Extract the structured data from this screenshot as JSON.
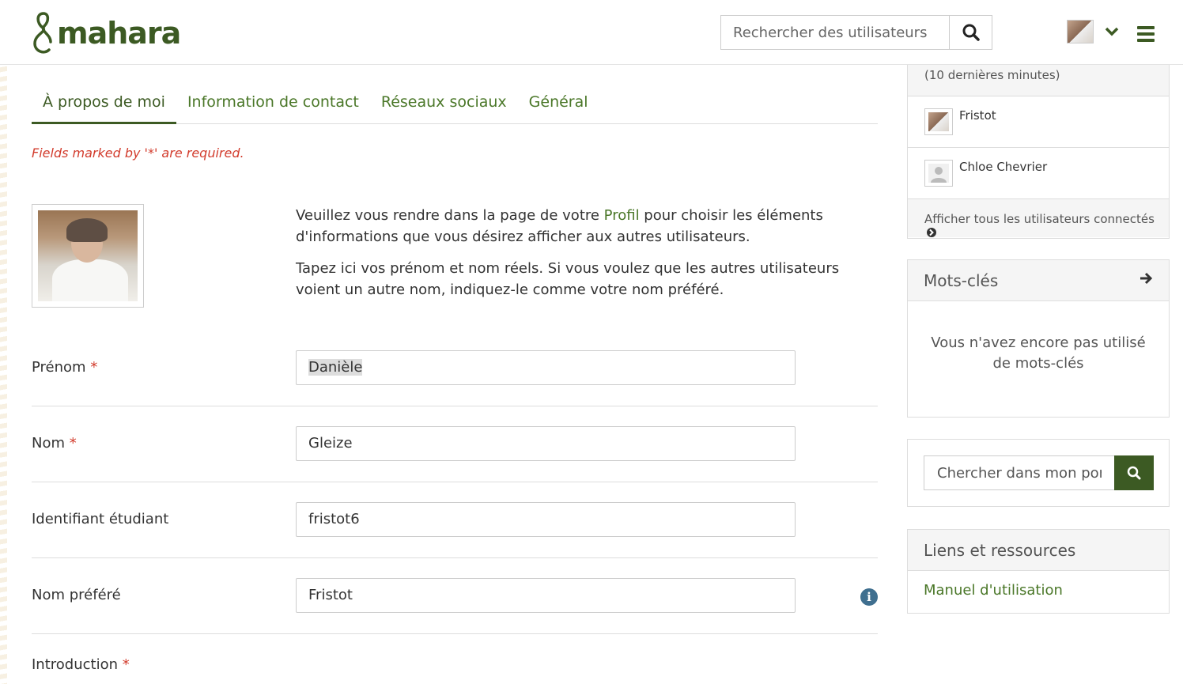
{
  "header": {
    "logo_text": "mahara",
    "search_placeholder": "Rechercher des utilisateurs"
  },
  "tabs": [
    {
      "label": "À propos de moi",
      "active": true
    },
    {
      "label": "Information de contact",
      "active": false
    },
    {
      "label": "Réseaux sociaux",
      "active": false
    },
    {
      "label": "Général",
      "active": false
    }
  ],
  "form": {
    "required_note": "Fields marked by '*' are required.",
    "intro_p1_before": "Veuillez vous rendre dans la page de votre ",
    "intro_p1_link": "Profil",
    "intro_p1_after": " pour choisir les éléments d'informations que vous désirez afficher aux autres utilisateurs.",
    "intro_p2": "Tapez ici vos prénom et nom réels. Si vous voulez que les autres utilisateurs voient un autre nom, indiquez-le comme votre nom préféré.",
    "required_star": "*",
    "fields": {
      "firstname": {
        "label": "Prénom",
        "value": "Danièle",
        "required": true
      },
      "lastname": {
        "label": "Nom",
        "value": "Gleize",
        "required": true
      },
      "studentid": {
        "label": "Identifiant étudiant",
        "value": "fristot6",
        "required": false
      },
      "preferredname": {
        "label": "Nom préféré",
        "value": "Fristot",
        "required": false
      },
      "introduction": {
        "label": "Introduction",
        "required": true
      }
    }
  },
  "sidebar": {
    "online_users": {
      "subtitle": "(10 dernières minutes)",
      "users": [
        {
          "name": "Fristot"
        },
        {
          "name": "Chloe Chevrier"
        }
      ],
      "show_all": "Afficher tous les utilisateurs connectés"
    },
    "tags": {
      "title": "Mots-clés",
      "empty_text": "Vous n'avez encore pas utilisé de mots-clés"
    },
    "portfolio_search": {
      "placeholder": "Chercher dans mon portfolio"
    },
    "links": {
      "title": "Liens et ressources",
      "items": [
        "Manuel d'utilisation"
      ]
    }
  },
  "colors": {
    "brand_green": "#3c5a23",
    "link_green": "#4a7728",
    "required_red": "#d23b2c",
    "info_blue": "#3f6f8f"
  }
}
